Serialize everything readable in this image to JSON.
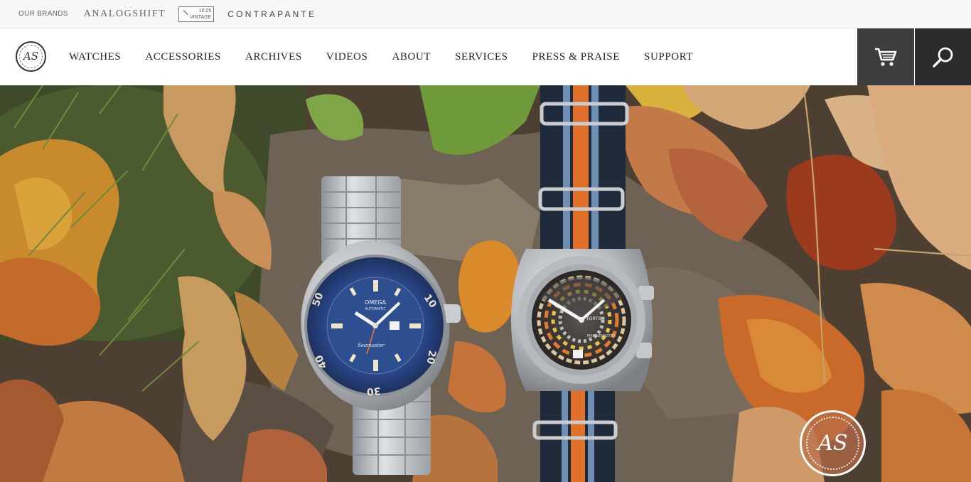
{
  "brand_bar": {
    "label": "OUR BRANDS",
    "brands": [
      "ANALOGSHIFT",
      "CONTRAPANTE"
    ],
    "vintage_logo": {
      "line1": "10:25",
      "line2": "VINTAGE"
    }
  },
  "header": {
    "logo_text": "AS",
    "nav": [
      "WATCHES",
      "ACCESSORIES",
      "ARCHIVES",
      "VIDEOS",
      "ABOUT",
      "SERVICES",
      "PRESS & PRAISE",
      "SUPPORT"
    ],
    "icons": {
      "cart": "cart-icon",
      "search": "search-icon"
    }
  },
  "hero": {
    "description_image": "two-vintage-watches-on-autumn-leaves",
    "watch_left": {
      "brand": "OMEGA",
      "sub": "AUTOMATIC",
      "model": "Seamaster",
      "bezel_numbers": [
        "10",
        "20",
        "30",
        "40",
        "50"
      ]
    },
    "watch_right": {
      "brand": "FORTIS",
      "model": "MARINEMASTER"
    },
    "badge_text": "AS"
  },
  "colors": {
    "topbar_bg": "#f7f7f7",
    "cart_bg": "#3d3d3d",
    "search_bg": "#2b2b2b",
    "badge_bg": "#b86e48"
  }
}
